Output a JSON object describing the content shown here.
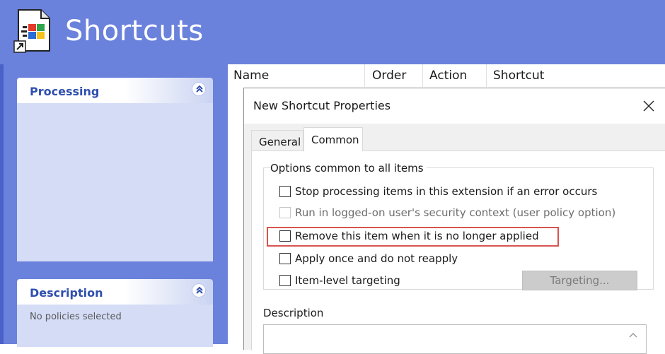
{
  "header": {
    "title": "Shortcuts",
    "icon": "shortcut-app-icon"
  },
  "sidebar": {
    "processing": {
      "title": "Processing",
      "collapse_icon": "double-chevron-up-icon"
    },
    "description": {
      "title": "Description",
      "text": "No policies selected",
      "collapse_icon": "double-chevron-up-icon"
    }
  },
  "list": {
    "columns": [
      "Name",
      "Order",
      "Action",
      "Shortcut"
    ]
  },
  "dialog": {
    "title": "New Shortcut Properties",
    "close_icon": "close-icon",
    "tabs": [
      {
        "label": "General",
        "selected": false
      },
      {
        "label": "Common",
        "selected": true
      }
    ],
    "group_title": "Options common to all items",
    "options": [
      {
        "label": "Stop processing items in this extension if an error occurs",
        "checked": false,
        "enabled": true
      },
      {
        "label": "Run in logged-on user's security context (user policy option)",
        "checked": false,
        "enabled": false
      },
      {
        "label": "Remove this item when it is no longer applied",
        "checked": false,
        "enabled": true,
        "highlighted": true
      },
      {
        "label": "Apply once and do not reapply",
        "checked": false,
        "enabled": true
      },
      {
        "label": "Item-level targeting",
        "checked": false,
        "enabled": true
      }
    ],
    "targeting_button": "Targeting...",
    "description_label": "Description",
    "description_value": ""
  },
  "colors": {
    "banner": "#6a82dc",
    "highlight": "#d9534f",
    "task_title": "#2f4fae"
  }
}
